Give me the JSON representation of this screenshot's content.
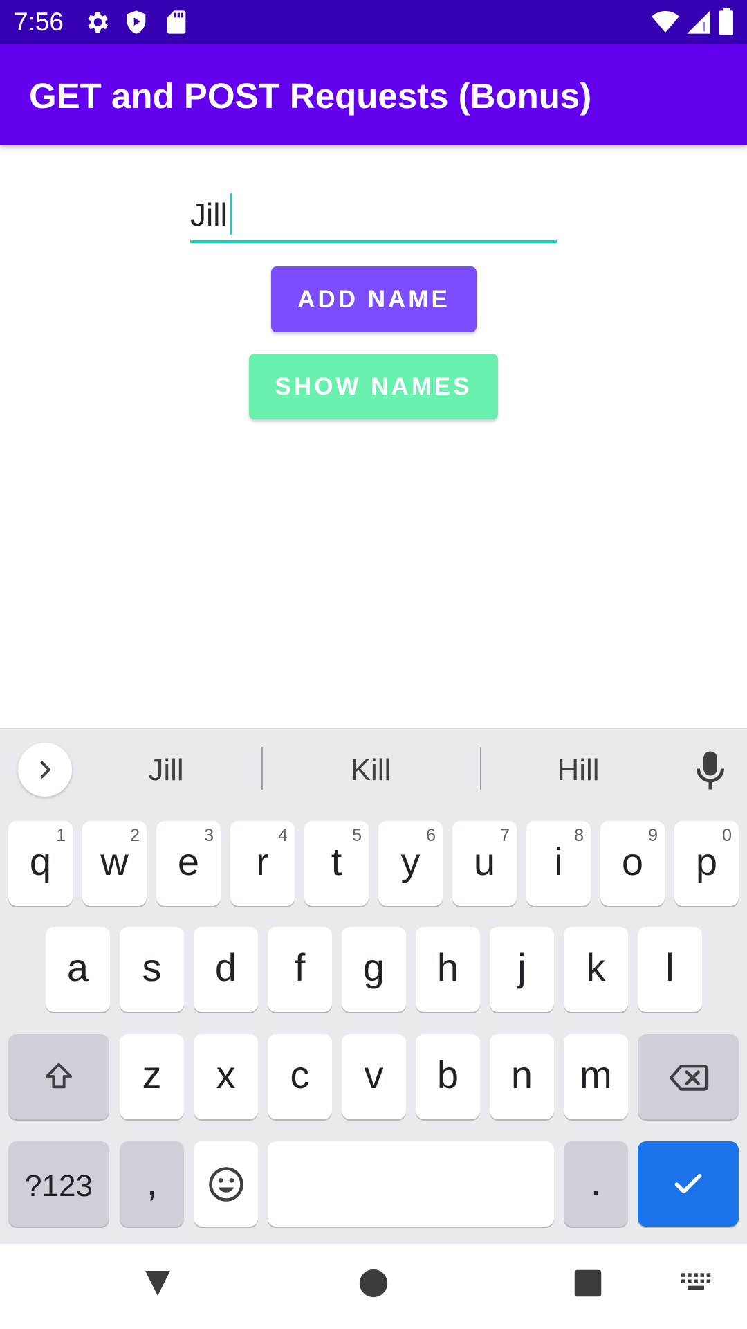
{
  "status_bar": {
    "time": "7:56",
    "left_icons": [
      "gear-icon",
      "shield-play-icon",
      "sd-card-icon"
    ],
    "right_icons": [
      "wifi-icon",
      "signal-icon",
      "battery-icon"
    ]
  },
  "app_bar": {
    "title": "GET and POST Requests (Bonus)"
  },
  "form": {
    "name_value": "Jill",
    "add_button_label": "ADD NAME",
    "show_button_label": "SHOW NAMES"
  },
  "colors": {
    "status_bar": "#3700b3",
    "app_bar": "#6200ee",
    "add_button": "#7c4dff",
    "show_button": "#69f0ae",
    "input_underline": "#14d2b8",
    "keyboard_enter": "#1a73e8"
  },
  "keyboard": {
    "suggestions": [
      "Jill",
      "Kill",
      "Hill"
    ],
    "row1": [
      {
        "key": "q",
        "hint": "1"
      },
      {
        "key": "w",
        "hint": "2"
      },
      {
        "key": "e",
        "hint": "3"
      },
      {
        "key": "r",
        "hint": "4"
      },
      {
        "key": "t",
        "hint": "5"
      },
      {
        "key": "y",
        "hint": "6"
      },
      {
        "key": "u",
        "hint": "7"
      },
      {
        "key": "i",
        "hint": "8"
      },
      {
        "key": "o",
        "hint": "9"
      },
      {
        "key": "p",
        "hint": "0"
      }
    ],
    "row2": [
      "a",
      "s",
      "d",
      "f",
      "g",
      "h",
      "j",
      "k",
      "l"
    ],
    "row3": [
      "z",
      "x",
      "c",
      "v",
      "b",
      "n",
      "m"
    ],
    "symbols_label": "?123",
    "comma_label": ",",
    "period_label": ".",
    "icons": [
      "shift-icon",
      "backspace-icon",
      "emoji-icon",
      "checkmark-icon",
      "chevron-right-icon",
      "microphone-icon"
    ]
  },
  "nav_bar": {
    "icons": [
      "back-icon",
      "home-icon",
      "recents-icon",
      "keyboard-switch-icon"
    ]
  }
}
